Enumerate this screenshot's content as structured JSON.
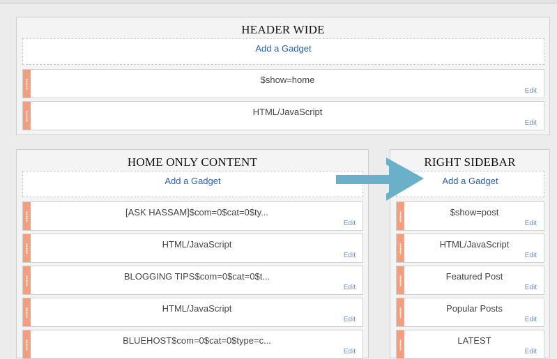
{
  "add_gadget_label": "Add a Gadget",
  "edit_label": "Edit",
  "sections": {
    "header_wide": {
      "title": "HEADER WIDE",
      "gadgets": [
        "$show=home",
        "HTML/JavaScript"
      ]
    },
    "home_only": {
      "title": "HOME ONLY CONTENT",
      "gadgets": [
        "[ASK HASSAM]$com=0$cat=0$ty...",
        "HTML/JavaScript",
        "BLOGGING TIPS$com=0$cat=0$t...",
        "HTML/JavaScript",
        "BLUEHOST$com=0$cat=0$type=c..."
      ]
    },
    "right_sidebar": {
      "title": "RIGHT SIDEBAR",
      "gadgets": [
        "$show=post",
        "HTML/JavaScript",
        "Featured Post",
        "Popular Posts",
        "LATEST"
      ]
    }
  },
  "colors": {
    "handle": "#f59d7c",
    "arrow": "#6ab0c8",
    "link": "#2b5fb3"
  }
}
